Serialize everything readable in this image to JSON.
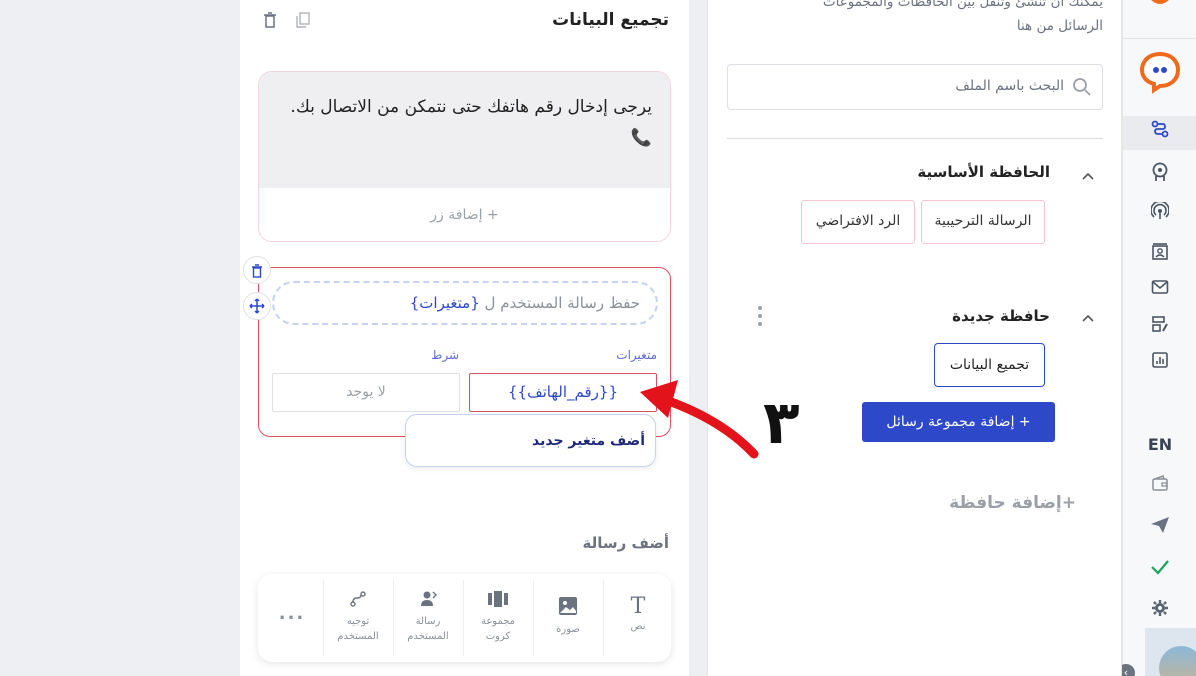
{
  "folders": {
    "top_hint_line1": "يمكنك أن تنشئ وتنقل بين الحافظات والمجموعات",
    "top_hint_line2": "الرسائل من هنا",
    "search_placeholder": "البحث باسم الملف",
    "basic_folder_title": "الحافظة الأساسية",
    "basic_items": [
      "الرسالة الترحيبية",
      "الرد الافتراضي"
    ],
    "new_folder_title": "حافظة جديدة",
    "new_folder_items": [
      "تجميع البيانات"
    ],
    "add_group_label": "+ إضافة مجموعة رسائل",
    "add_folder_label": "+إضافة حافظة"
  },
  "editor": {
    "title": "تجميع البيانات",
    "message_text": "يرجى إدخال رقم هاتفك حتى نتمكن من الاتصال بك. 📞",
    "add_button_label": "+ إضافة زر",
    "input_title": "حفظ رسالة المستخدم ل",
    "input_title_var": "{متغيرات}",
    "variables_label": "متغيرات",
    "condition_label": "شرط",
    "variable_value": "{{رقم_الهاتف}}",
    "condition_value": "لا يوجد",
    "add_variable_label": "أضف متغير جديد",
    "add_message_heading": "أضف رسالة",
    "message_types": [
      {
        "label": "نص",
        "icon": "text-icon"
      },
      {
        "label": "صورة",
        "icon": "image-icon"
      },
      {
        "label": "مجموعة كروت",
        "icon": "cards-icon"
      },
      {
        "label": "رسالة المستخدم",
        "icon": "user-message-icon"
      },
      {
        "label": "توجيه المستخدم",
        "icon": "route-icon"
      }
    ],
    "more_label": "..."
  },
  "annotation": {
    "step_number": "٣",
    "arrow_color": "#e3131b"
  },
  "sidebar": {
    "language_label": "EN"
  },
  "colors": {
    "accent_blue": "#2d49c9",
    "brand_orange": "#f06a1d",
    "pink_border": "#f3c6cf",
    "red_border": "#d9535e"
  }
}
